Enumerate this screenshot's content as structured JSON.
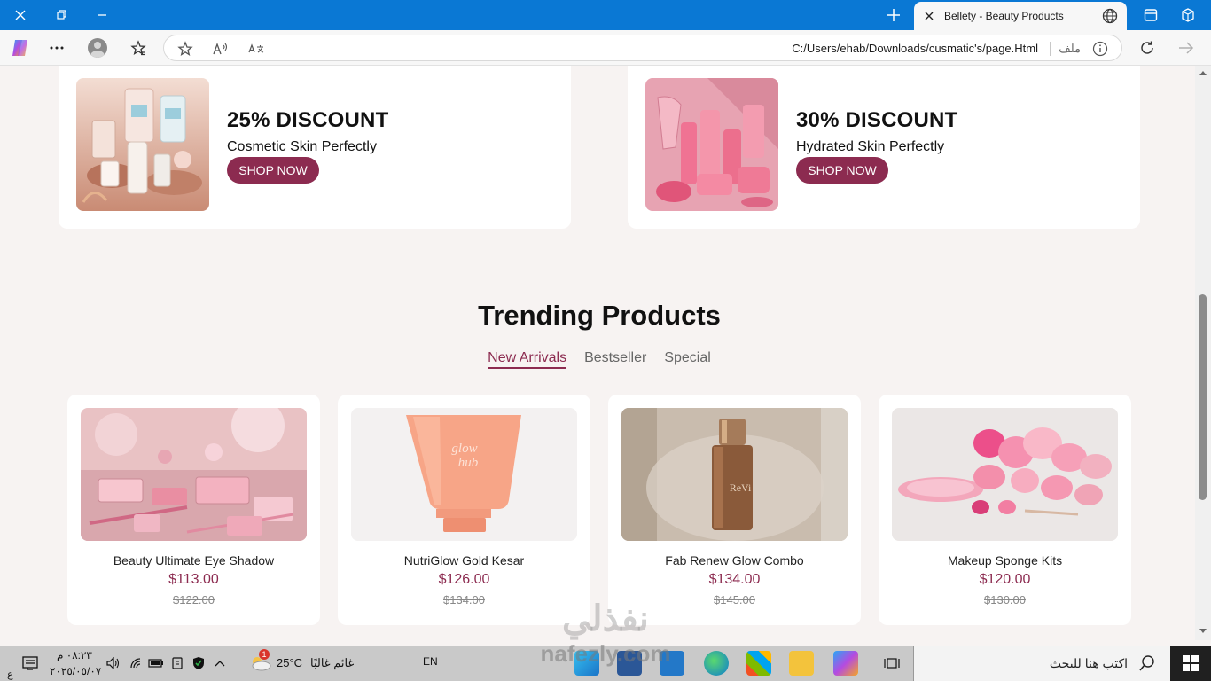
{
  "browser": {
    "tab_title": "Bellety - Beauty Products",
    "url": "C:/Users/ehab/Downloads/cusmatic's/page.Html",
    "file_label": "ملف"
  },
  "promos": [
    {
      "title": "25% DISCOUNT",
      "subtitle": "Cosmetic Skin Perfectly",
      "button": "SHOP NOW"
    },
    {
      "title": "30% DISCOUNT",
      "subtitle": "Hydrated Skin Perfectly",
      "button": "SHOP NOW"
    }
  ],
  "trending": {
    "title": "Trending Products",
    "tabs": [
      {
        "label": "New Arrivals",
        "active": true
      },
      {
        "label": "Bestseller",
        "active": false
      },
      {
        "label": "Special",
        "active": false
      }
    ],
    "products": [
      {
        "name": "Beauty Ultimate Eye Shadow",
        "price": "$113.00",
        "old_price": "$122.00"
      },
      {
        "name": "NutriGlow Gold Kesar",
        "price": "$126.00",
        "old_price": "$134.00"
      },
      {
        "name": "Fab Renew Glow Combo",
        "price": "$134.00",
        "old_price": "$145.00"
      },
      {
        "name": "Makeup Sponge Kits",
        "price": "$120.00",
        "old_price": "$130.00"
      }
    ]
  },
  "watermark": {
    "arabic": "نفذلي",
    "latin": "nafezly.com"
  },
  "taskbar": {
    "time": "٠٨:٢٣ م",
    "date": "٢٠٢٥/٠٥/٠٧",
    "lang": "EN",
    "temperature": "25°C",
    "weather": "غائم غالبًا",
    "weather_badge": "1",
    "search_placeholder": "اكتب هنا للبحث",
    "ime_char": "ع"
  },
  "colors": {
    "accent": "#8c2b50",
    "titlebar": "#0a78d4"
  }
}
